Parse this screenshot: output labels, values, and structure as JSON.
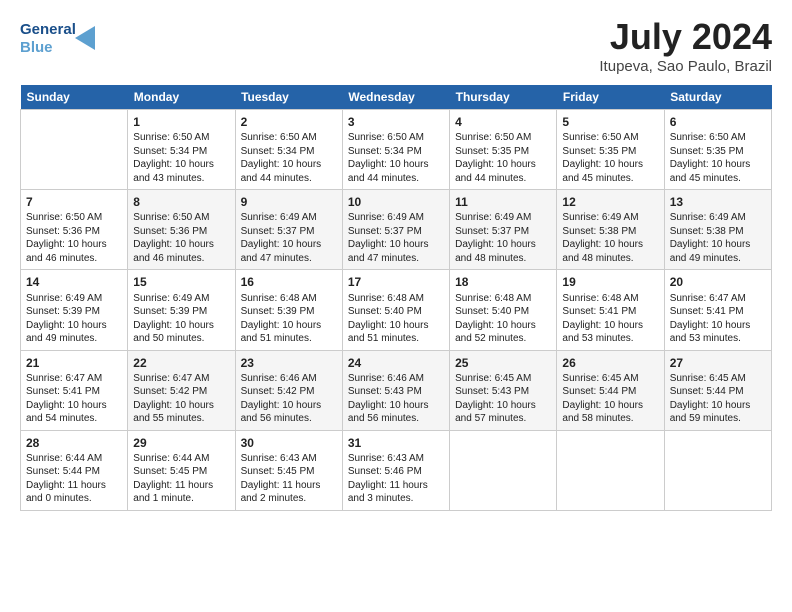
{
  "header": {
    "logo_line1": "General",
    "logo_line2": "Blue",
    "title": "July 2024",
    "subtitle": "Itupeva, Sao Paulo, Brazil"
  },
  "calendar": {
    "weekdays": [
      "Sunday",
      "Monday",
      "Tuesday",
      "Wednesday",
      "Thursday",
      "Friday",
      "Saturday"
    ],
    "weeks": [
      [
        {
          "date": "",
          "lines": []
        },
        {
          "date": "1",
          "lines": [
            "Sunrise: 6:50 AM",
            "Sunset: 5:34 PM",
            "Daylight: 10 hours",
            "and 43 minutes."
          ]
        },
        {
          "date": "2",
          "lines": [
            "Sunrise: 6:50 AM",
            "Sunset: 5:34 PM",
            "Daylight: 10 hours",
            "and 44 minutes."
          ]
        },
        {
          "date": "3",
          "lines": [
            "Sunrise: 6:50 AM",
            "Sunset: 5:34 PM",
            "Daylight: 10 hours",
            "and 44 minutes."
          ]
        },
        {
          "date": "4",
          "lines": [
            "Sunrise: 6:50 AM",
            "Sunset: 5:35 PM",
            "Daylight: 10 hours",
            "and 44 minutes."
          ]
        },
        {
          "date": "5",
          "lines": [
            "Sunrise: 6:50 AM",
            "Sunset: 5:35 PM",
            "Daylight: 10 hours",
            "and 45 minutes."
          ]
        },
        {
          "date": "6",
          "lines": [
            "Sunrise: 6:50 AM",
            "Sunset: 5:35 PM",
            "Daylight: 10 hours",
            "and 45 minutes."
          ]
        }
      ],
      [
        {
          "date": "7",
          "lines": [
            "Sunrise: 6:50 AM",
            "Sunset: 5:36 PM",
            "Daylight: 10 hours",
            "and 46 minutes."
          ]
        },
        {
          "date": "8",
          "lines": [
            "Sunrise: 6:50 AM",
            "Sunset: 5:36 PM",
            "Daylight: 10 hours",
            "and 46 minutes."
          ]
        },
        {
          "date": "9",
          "lines": [
            "Sunrise: 6:49 AM",
            "Sunset: 5:37 PM",
            "Daylight: 10 hours",
            "and 47 minutes."
          ]
        },
        {
          "date": "10",
          "lines": [
            "Sunrise: 6:49 AM",
            "Sunset: 5:37 PM",
            "Daylight: 10 hours",
            "and 47 minutes."
          ]
        },
        {
          "date": "11",
          "lines": [
            "Sunrise: 6:49 AM",
            "Sunset: 5:37 PM",
            "Daylight: 10 hours",
            "and 48 minutes."
          ]
        },
        {
          "date": "12",
          "lines": [
            "Sunrise: 6:49 AM",
            "Sunset: 5:38 PM",
            "Daylight: 10 hours",
            "and 48 minutes."
          ]
        },
        {
          "date": "13",
          "lines": [
            "Sunrise: 6:49 AM",
            "Sunset: 5:38 PM",
            "Daylight: 10 hours",
            "and 49 minutes."
          ]
        }
      ],
      [
        {
          "date": "14",
          "lines": [
            "Sunrise: 6:49 AM",
            "Sunset: 5:39 PM",
            "Daylight: 10 hours",
            "and 49 minutes."
          ]
        },
        {
          "date": "15",
          "lines": [
            "Sunrise: 6:49 AM",
            "Sunset: 5:39 PM",
            "Daylight: 10 hours",
            "and 50 minutes."
          ]
        },
        {
          "date": "16",
          "lines": [
            "Sunrise: 6:48 AM",
            "Sunset: 5:39 PM",
            "Daylight: 10 hours",
            "and 51 minutes."
          ]
        },
        {
          "date": "17",
          "lines": [
            "Sunrise: 6:48 AM",
            "Sunset: 5:40 PM",
            "Daylight: 10 hours",
            "and 51 minutes."
          ]
        },
        {
          "date": "18",
          "lines": [
            "Sunrise: 6:48 AM",
            "Sunset: 5:40 PM",
            "Daylight: 10 hours",
            "and 52 minutes."
          ]
        },
        {
          "date": "19",
          "lines": [
            "Sunrise: 6:48 AM",
            "Sunset: 5:41 PM",
            "Daylight: 10 hours",
            "and 53 minutes."
          ]
        },
        {
          "date": "20",
          "lines": [
            "Sunrise: 6:47 AM",
            "Sunset: 5:41 PM",
            "Daylight: 10 hours",
            "and 53 minutes."
          ]
        }
      ],
      [
        {
          "date": "21",
          "lines": [
            "Sunrise: 6:47 AM",
            "Sunset: 5:41 PM",
            "Daylight: 10 hours",
            "and 54 minutes."
          ]
        },
        {
          "date": "22",
          "lines": [
            "Sunrise: 6:47 AM",
            "Sunset: 5:42 PM",
            "Daylight: 10 hours",
            "and 55 minutes."
          ]
        },
        {
          "date": "23",
          "lines": [
            "Sunrise: 6:46 AM",
            "Sunset: 5:42 PM",
            "Daylight: 10 hours",
            "and 56 minutes."
          ]
        },
        {
          "date": "24",
          "lines": [
            "Sunrise: 6:46 AM",
            "Sunset: 5:43 PM",
            "Daylight: 10 hours",
            "and 56 minutes."
          ]
        },
        {
          "date": "25",
          "lines": [
            "Sunrise: 6:45 AM",
            "Sunset: 5:43 PM",
            "Daylight: 10 hours",
            "and 57 minutes."
          ]
        },
        {
          "date": "26",
          "lines": [
            "Sunrise: 6:45 AM",
            "Sunset: 5:44 PM",
            "Daylight: 10 hours",
            "and 58 minutes."
          ]
        },
        {
          "date": "27",
          "lines": [
            "Sunrise: 6:45 AM",
            "Sunset: 5:44 PM",
            "Daylight: 10 hours",
            "and 59 minutes."
          ]
        }
      ],
      [
        {
          "date": "28",
          "lines": [
            "Sunrise: 6:44 AM",
            "Sunset: 5:44 PM",
            "Daylight: 11 hours",
            "and 0 minutes."
          ]
        },
        {
          "date": "29",
          "lines": [
            "Sunrise: 6:44 AM",
            "Sunset: 5:45 PM",
            "Daylight: 11 hours",
            "and 1 minute."
          ]
        },
        {
          "date": "30",
          "lines": [
            "Sunrise: 6:43 AM",
            "Sunset: 5:45 PM",
            "Daylight: 11 hours",
            "and 2 minutes."
          ]
        },
        {
          "date": "31",
          "lines": [
            "Sunrise: 6:43 AM",
            "Sunset: 5:46 PM",
            "Daylight: 11 hours",
            "and 3 minutes."
          ]
        },
        {
          "date": "",
          "lines": []
        },
        {
          "date": "",
          "lines": []
        },
        {
          "date": "",
          "lines": []
        }
      ]
    ]
  }
}
